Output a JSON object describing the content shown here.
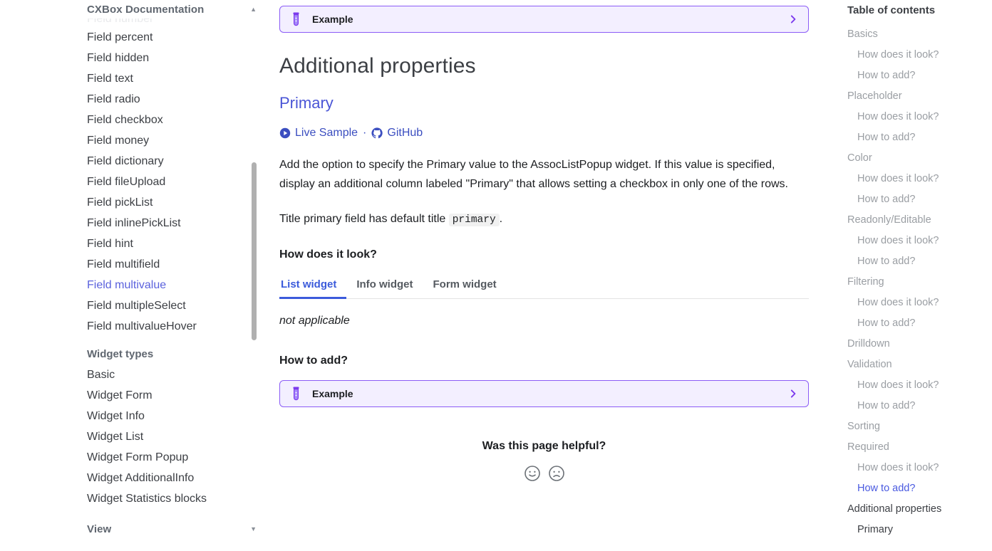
{
  "sidebar": {
    "category_title": "CXBox Documentation",
    "category_caret": "collapse-caret-up",
    "faded_item": "Field number",
    "items": [
      {
        "label": "Field percent",
        "active": false
      },
      {
        "label": "Field hidden",
        "active": false
      },
      {
        "label": "Field text",
        "active": false
      },
      {
        "label": "Field radio",
        "active": false
      },
      {
        "label": "Field checkbox",
        "active": false
      },
      {
        "label": "Field money",
        "active": false
      },
      {
        "label": "Field dictionary",
        "active": false
      },
      {
        "label": "Field fileUpload",
        "active": false
      },
      {
        "label": "Field pickList",
        "active": false
      },
      {
        "label": "Field inlinePickList",
        "active": false
      },
      {
        "label": "Field hint",
        "active": false
      },
      {
        "label": "Field multifield",
        "active": false
      },
      {
        "label": "Field multivalue",
        "active": true
      },
      {
        "label": "Field multipleSelect",
        "active": false
      },
      {
        "label": "Field multivalueHover",
        "active": false
      }
    ],
    "group_label": "Widget types",
    "group_items": [
      {
        "label": "Basic"
      },
      {
        "label": "Widget Form"
      },
      {
        "label": "Widget Info"
      },
      {
        "label": "Widget List"
      },
      {
        "label": "Widget Form Popup"
      },
      {
        "label": "Widget AdditionalInfo"
      },
      {
        "label": "Widget Statistics blocks"
      }
    ],
    "bottom_category": "View",
    "bottom_caret": "expand-caret-down"
  },
  "main": {
    "top_example": {
      "label": "Example",
      "icon": "test-tube-icon",
      "chevron": "chevron-right-icon"
    },
    "heading": "Additional properties",
    "subheading": "Primary",
    "links": {
      "live_sample": "Live Sample",
      "separator": "·",
      "github": "GitHub"
    },
    "paragraph_1": "Add the option to specify the Primary value to the AssocListPopup widget. If this value is specified, display an additional column labeled \"Primary\" that allows setting a checkbox in only one of the rows.",
    "paragraph_2_before": "Title primary field has default title",
    "paragraph_2_code": "primary",
    "paragraph_2_after": ".",
    "q_how_look": "How does it look?",
    "tabs": [
      {
        "label": "List widget",
        "active": true
      },
      {
        "label": "Info widget",
        "active": false
      },
      {
        "label": "Form widget",
        "active": false
      }
    ],
    "tab_content": "not applicable",
    "q_how_add": "How to add?",
    "bottom_example": {
      "label": "Example",
      "icon": "test-tube-icon",
      "chevron": "chevron-right-icon"
    },
    "feedback": {
      "title": "Was this page helpful?",
      "positive_icon": "smiley-happy-icon",
      "negative_icon": "smiley-sad-icon"
    }
  },
  "toc": {
    "title": "Table of contents",
    "items": [
      {
        "label": "Basics",
        "level": 1,
        "state": "muted"
      },
      {
        "label": "How does it look?",
        "level": 2,
        "state": "muted"
      },
      {
        "label": "How to add?",
        "level": 2,
        "state": "muted"
      },
      {
        "label": "Placeholder",
        "level": 1,
        "state": "muted"
      },
      {
        "label": "How does it look?",
        "level": 2,
        "state": "muted"
      },
      {
        "label": "How to add?",
        "level": 2,
        "state": "muted"
      },
      {
        "label": "Color",
        "level": 1,
        "state": "muted"
      },
      {
        "label": "How does it look?",
        "level": 2,
        "state": "muted"
      },
      {
        "label": "How to add?",
        "level": 2,
        "state": "muted"
      },
      {
        "label": "Readonly/Editable",
        "level": 1,
        "state": "muted"
      },
      {
        "label": "How does it look?",
        "level": 2,
        "state": "muted"
      },
      {
        "label": "How to add?",
        "level": 2,
        "state": "muted"
      },
      {
        "label": "Filtering",
        "level": 1,
        "state": "muted"
      },
      {
        "label": "How does it look?",
        "level": 2,
        "state": "muted"
      },
      {
        "label": "How to add?",
        "level": 2,
        "state": "muted"
      },
      {
        "label": "Drilldown",
        "level": 1,
        "state": "muted"
      },
      {
        "label": "Validation",
        "level": 1,
        "state": "muted"
      },
      {
        "label": "How does it look?",
        "level": 2,
        "state": "muted"
      },
      {
        "label": "How to add?",
        "level": 2,
        "state": "muted"
      },
      {
        "label": "Sorting",
        "level": 1,
        "state": "muted"
      },
      {
        "label": "Required",
        "level": 1,
        "state": "muted"
      },
      {
        "label": "How does it look?",
        "level": 2,
        "state": "muted"
      },
      {
        "label": "How to add?",
        "level": 2,
        "state": "active"
      },
      {
        "label": "Additional properties",
        "level": 1,
        "state": "dark"
      },
      {
        "label": "Primary",
        "level": 2,
        "state": "dark"
      }
    ]
  },
  "colors": {
    "accent_purple": "#8b5cf6",
    "example_bg": "#f3efff",
    "link_blue": "#3b4ec0",
    "tab_active": "#3b5bdb",
    "sidebar_active": "#5b62dd",
    "toc_muted": "#9a9ea3"
  }
}
